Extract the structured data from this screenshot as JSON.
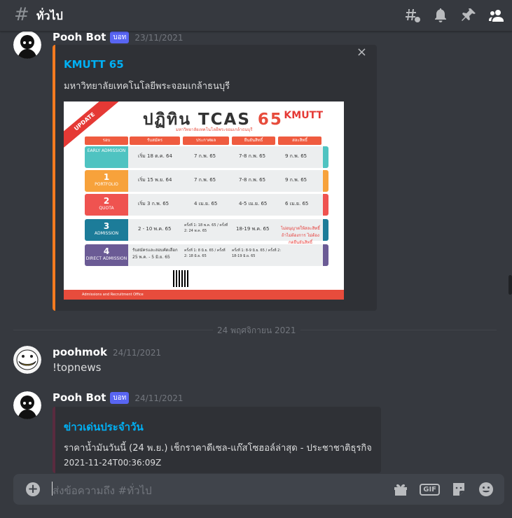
{
  "channel": {
    "name": "ทั่วไป"
  },
  "messages": [
    {
      "author": "Pooh Bot",
      "tag": "บอท",
      "timestamp": "23/11/2021",
      "embed": {
        "title": "KMUTT 65",
        "description": "มหาวิทยาลัยเทคโนโลยีพระจอมเกล้าธนบุรี",
        "poster": {
          "title_a": "ปฏิทิน",
          "title_b": "TCAS",
          "title_c": "65",
          "subtitle": "มหาวิทยาลัยเทคโนโลยีพระจอมเกล้าธนบุรี",
          "ribbon": "UPDATE",
          "logo": "KMUTT",
          "headers": [
            "รอบ",
            "รับสมัคร",
            "ประกาศผล",
            "ยืนยันสิทธิ์",
            "สละสิทธิ์"
          ],
          "rounds": [
            {
              "num": "",
              "name": "EARLY ADMISSION",
              "apply": "เริ่ม 18 ต.ค. 64",
              "announce": "7 ก.พ. 65",
              "confirm": "7-8 ก.พ. 65",
              "waive": "9 ก.พ. 65",
              "color": "#4fc3c1"
            },
            {
              "num": "1",
              "name": "PORTFOLIO",
              "apply": "เริ่ม 15 พ.ย. 64",
              "announce": "7 ก.พ. 65",
              "confirm": "7-8 ก.พ. 65",
              "waive": "9 ก.พ. 65",
              "color": "#f7a23b"
            },
            {
              "num": "2",
              "name": "QUOTA",
              "apply": "เริ่ม 3 ก.พ. 65",
              "announce": "4 เม.ย. 65",
              "confirm": "4-5 เม.ย. 65",
              "waive": "6 เม.ย. 65",
              "color": "#ef5350"
            },
            {
              "num": "3",
              "name": "ADMISSION",
              "apply": "2 - 10 พ.ค. 65",
              "announce": "ครั้งที่ 1: 18 พ.ค. 65 / ครั้งที่ 2: 24 พ.ค. 65",
              "confirm": "18-19 พ.ค. 65",
              "waive": "",
              "color": "#1c7c99"
            },
            {
              "num": "4",
              "name": "DIRECT ADMISSION",
              "apply": "รับสมัครและสอบคัดเลือก 25 พ.ค. - 5 มิ.ย. 65",
              "announce": "ครั้งที่ 1: 8 มิ.ย. 65 / ครั้งที่ 2: 18 มิ.ย. 65",
              "confirm": "ครั้งที่ 1: 8-9 มิ.ย. 65 / ครั้งที่ 2: 18-19 มิ.ย. 65",
              "waive": "",
              "color": "#6b5b95"
            }
          ],
          "special": "ไม่อนุญาตให้สละสิทธิ์ ถ้าไม่ต้องการ ไม่ต้องกดยืนยันสิทธิ์",
          "footer": "Admissions and Recruitment Office"
        }
      }
    },
    {
      "author": "poohmok",
      "timestamp": "24/11/2021",
      "content": "!topnews"
    },
    {
      "author": "Pooh Bot",
      "tag": "บอท",
      "timestamp": "24/11/2021",
      "embed": {
        "title": "ข่าวเด่นประจำวัน",
        "description": "ราคาน้ำมันวันนี้ (24 พ.ย.) เช็กราคาดีเซล-แก๊สโซฮอล์ล่าสุด - ประชาชาติธุรกิจ",
        "time": "2021-11-24T00:36:09Z"
      }
    }
  ],
  "divider": "24 พฤศจิกายน 2021",
  "input": {
    "placeholder": "ส่งข้อความถึง #ทั่วไป"
  },
  "icons": [
    "hash-icon",
    "threads-icon",
    "bell-icon",
    "pin-icon",
    "members-icon",
    "plus-icon",
    "gift-icon",
    "gif-icon",
    "sticker-icon",
    "emoji-icon",
    "close-icon"
  ]
}
